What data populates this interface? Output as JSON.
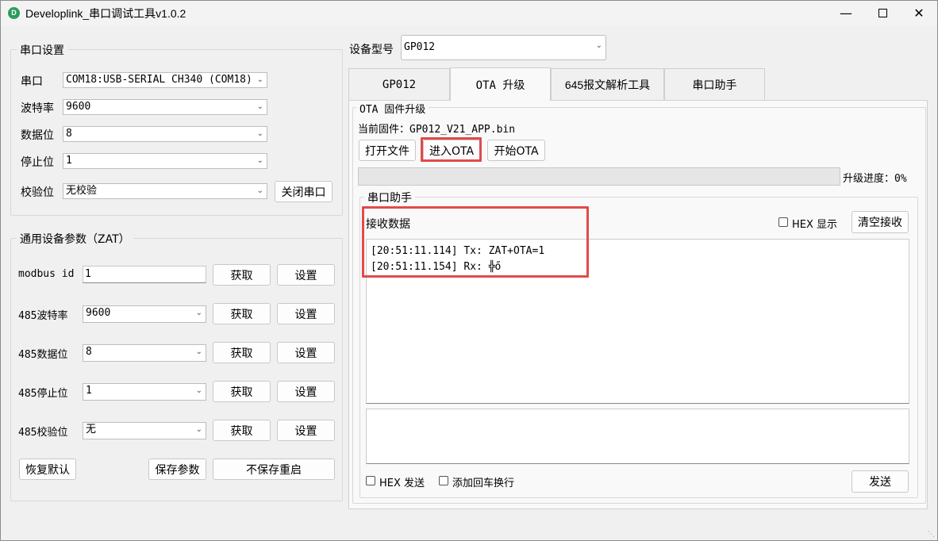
{
  "window": {
    "title": "Developlink_串口调试工具v1.0.2",
    "icon_letter": "D"
  },
  "serial_settings": {
    "title": "串口设置",
    "port": {
      "label": "串口",
      "value": "COM18:USB-SERIAL CH340 (COM18)"
    },
    "baud": {
      "label": "波特率",
      "value": "9600"
    },
    "databits": {
      "label": "数据位",
      "value": "8"
    },
    "stopbits": {
      "label": "停止位",
      "value": "1"
    },
    "parity": {
      "label": "校验位",
      "value": "无校验"
    },
    "close_port_button": "关闭串口"
  },
  "device_params": {
    "title": "通用设备参数（ZAT）",
    "rows": [
      {
        "label": "modbus id",
        "value": "1",
        "get": "获取",
        "set": "设置"
      },
      {
        "label": "485波特率",
        "value": "9600",
        "get": "获取",
        "set": "设置"
      },
      {
        "label": "485数据位",
        "value": "8",
        "get": "获取",
        "set": "设置"
      },
      {
        "label": "485停止位",
        "value": "1",
        "get": "获取",
        "set": "设置"
      },
      {
        "label": "485校验位",
        "value": "无",
        "get": "获取",
        "set": "设置"
      }
    ],
    "restore_button": "恢复默认",
    "save_button": "保存参数",
    "nosave_restart_button": "不保存重启"
  },
  "device_model": {
    "label": "设备型号",
    "value": "GP012"
  },
  "tabs": [
    "GP012",
    "OTA 升级",
    "645报文解析工具",
    "串口助手"
  ],
  "ota": {
    "group_title": "OTA 固件升级",
    "current_fw_label": "当前固件：",
    "current_fw_value": "GP012_V21_APP.bin",
    "open_file_button": "打开文件",
    "enter_ota_button": "进入OTA",
    "start_ota_button": "开始OTA",
    "progress_label": "升级进度：",
    "progress_value": "0%",
    "progress_fraction": 0
  },
  "serial_assistant": {
    "group_title": "串口助手",
    "receive_label": "接收数据",
    "hex_display_label": "HEX 显示",
    "clear_button": "清空接收",
    "log": [
      "[20:51:11.114] Tx: ZAT+OTA=1",
      "[20:51:11.154] Rx: ╬ő"
    ],
    "hex_send_label": "HEX 发送",
    "add_crlf_label": "添加回车换行",
    "send_button": "发送"
  },
  "colors": {
    "highlight": "#e24a4a",
    "app_icon": "#2a9d5c"
  }
}
